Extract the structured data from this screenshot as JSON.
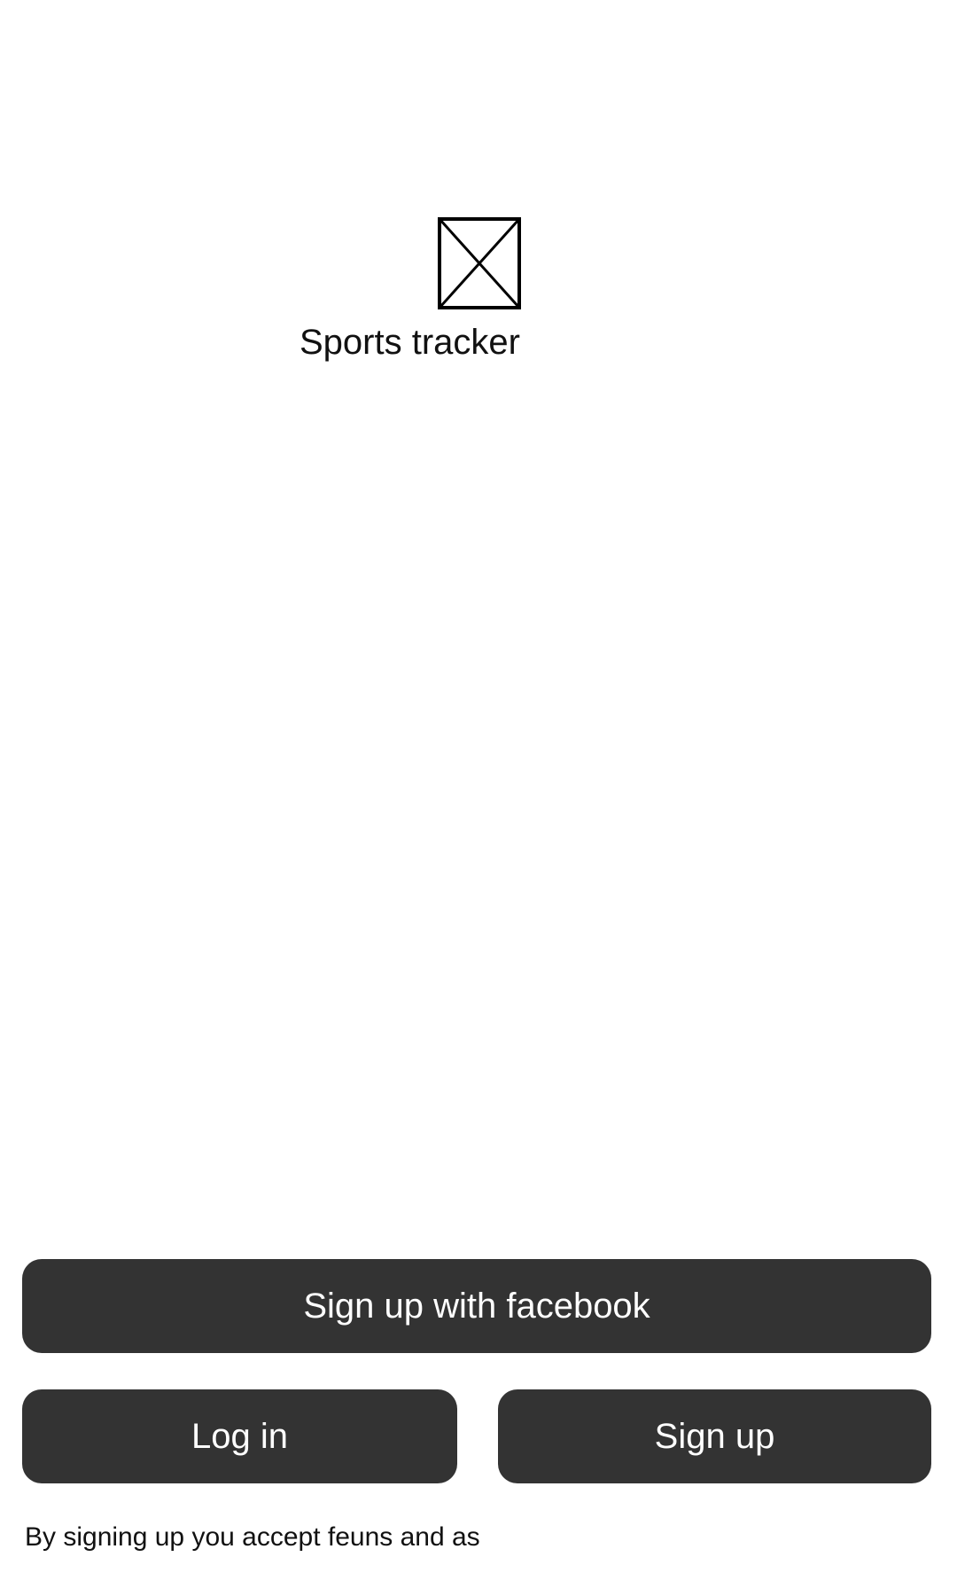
{
  "app": {
    "title": "Sports tracker",
    "logo_icon": "image-placeholder-icon"
  },
  "actions": {
    "facebook_signup_label": "Sign up with facebook",
    "login_label": "Log in",
    "signup_label": "Sign up"
  },
  "footer": {
    "terms_text": "By signing up you accept feuns and as"
  },
  "colors": {
    "button_background": "#333333",
    "button_text": "#ffffff",
    "page_background": "#ffffff",
    "text": "#111111"
  }
}
